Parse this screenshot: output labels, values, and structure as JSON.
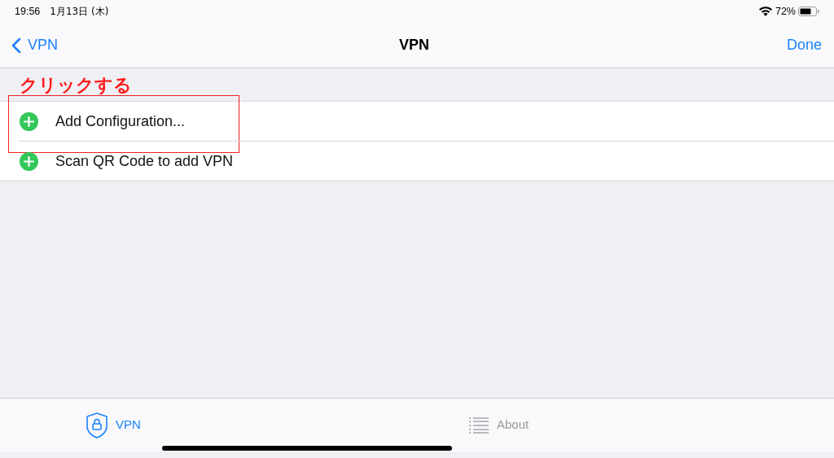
{
  "status_bar": {
    "time": "19:56",
    "date": "1月13日 (木)",
    "battery": "72%"
  },
  "nav_bar": {
    "back": "VPN",
    "title": "VPN",
    "action": "Done"
  },
  "annotation": {
    "text": "クリックする"
  },
  "items": [
    {
      "label": "Add Configuration...",
      "highlighted": true
    },
    {
      "label": "Scan QR Code to add VPN",
      "highlighted": false
    }
  ],
  "tabs": [
    {
      "label": "VPN",
      "selected": true,
      "kind": "shield"
    },
    {
      "label": "About",
      "selected": false,
      "kind": "list"
    }
  ]
}
